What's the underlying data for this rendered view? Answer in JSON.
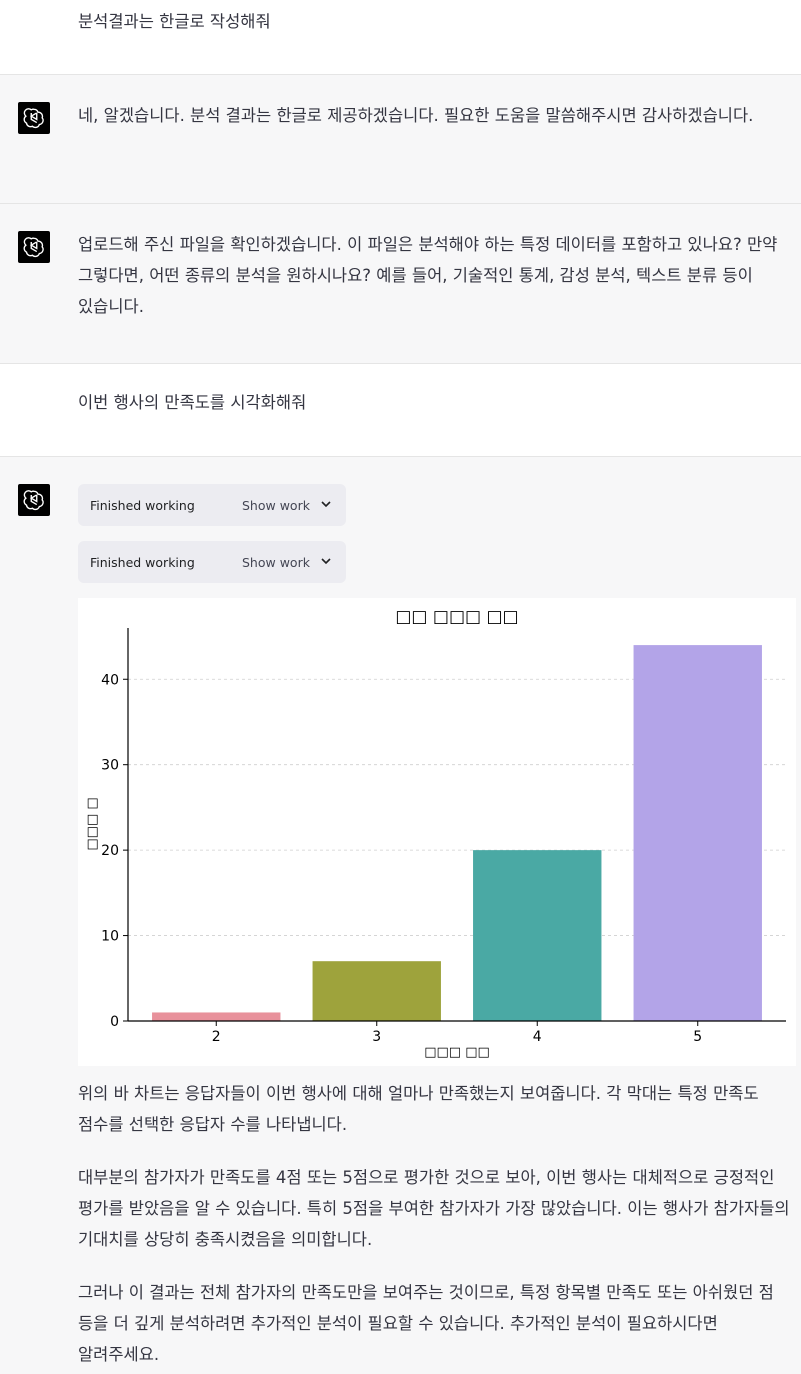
{
  "messages": {
    "user1": "분석결과는 한글로 작성해줘",
    "assistant1": "네, 알겠습니다. 분석 결과는 한글로 제공하겠습니다. 필요한 도움을 말씀해주시면 감사하겠습니다.",
    "assistant2": "업로드해 주신 파일을 확인하겠습니다. 이 파일은 분석해야 하는 특정 데이터를 포함하고 있나요? 만약 그렇다면, 어떤 종류의 분석을 원하시나요? 예를 들어, 기술적인 통계, 감성 분석, 텍스트 분류 등이 있습니다.",
    "user2": "이번 행사의 만족도를 시각화해줘"
  },
  "work_chips": [
    {
      "status": "Finished working",
      "toggle": "Show work"
    },
    {
      "status": "Finished working",
      "toggle": "Show work"
    }
  ],
  "chart_data": {
    "type": "bar",
    "title": "□□ □□□ □□",
    "xlabel": "□□□ □□",
    "ylabel": "□□□ □",
    "categories": [
      "2",
      "3",
      "4",
      "5"
    ],
    "values": [
      1,
      7,
      20,
      44
    ],
    "colors": [
      "#e8919b",
      "#9ea33c",
      "#4aa9a4",
      "#b3a4e8"
    ],
    "ylim": [
      0,
      46
    ],
    "yticks": [
      0,
      10,
      20,
      30,
      40
    ],
    "grid": true
  },
  "response": {
    "p1": "위의 바 차트는 응답자들이 이번 행사에 대해 얼마나 만족했는지 보여줍니다. 각 막대는 특정 만족도 점수를 선택한 응답자 수를 나타냅니다.",
    "p2": "대부분의 참가자가 만족도를 4점 또는 5점으로 평가한 것으로 보아, 이번 행사는 대체적으로 긍정적인 평가를 받았음을 알 수 있습니다. 특히 5점을 부여한 참가자가 가장 많았습니다. 이는 행사가 참가자들의 기대치를 상당히 충족시켰음을 의미합니다.",
    "p3": "그러나 이 결과는 전체 참가자의 만족도만을 보여주는 것이므로, 특정 항목별 만족도 또는 아쉬웠던 점 등을 더 깊게 분석하려면 추가적인 분석이 필요할 수 있습니다. 추가적인 분석이 필요하시다면 알려주세요."
  }
}
